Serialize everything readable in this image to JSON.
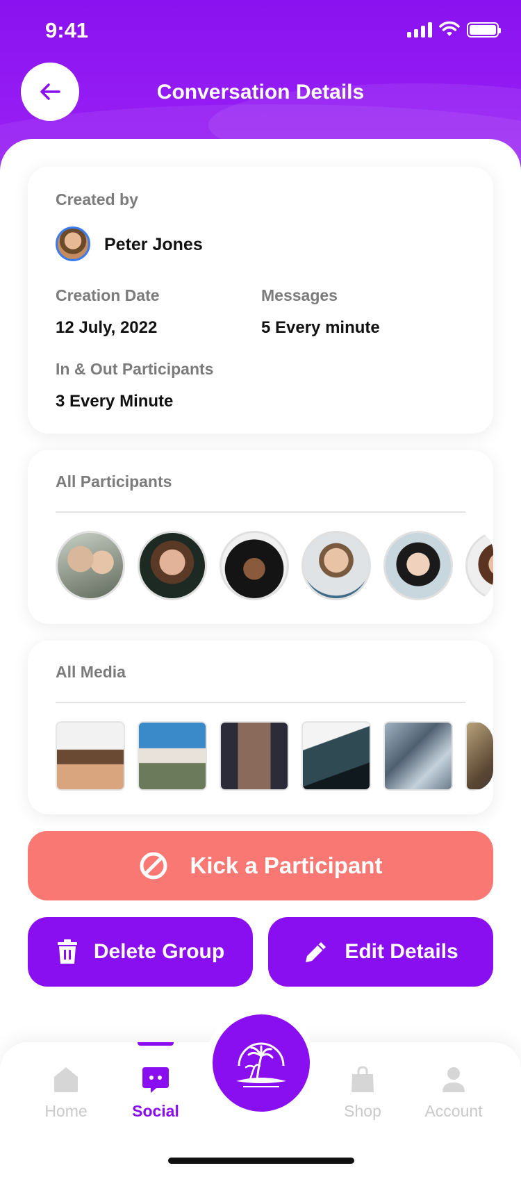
{
  "status_bar": {
    "time": "9:41"
  },
  "header": {
    "title": "Conversation Details"
  },
  "details_card": {
    "created_by_label": "Created by",
    "creator_name": "Peter Jones",
    "creation_date_label": "Creation Date",
    "creation_date_value": "12 July, 2022",
    "messages_label": "Messages",
    "messages_value": "5 Every minute",
    "participants_label": "In & Out Participants",
    "participants_value": "3 Every Minute"
  },
  "participants_card": {
    "title": "All Participants"
  },
  "media_card": {
    "title": "All Media"
  },
  "actions": {
    "kick_label": "Kick a Participant",
    "delete_label": "Delete Group",
    "edit_label": "Edit Details"
  },
  "bottom_nav": {
    "items": [
      {
        "label": "Home",
        "icon": "home-icon",
        "active": false
      },
      {
        "label": "Social",
        "icon": "chat-icon",
        "active": true
      },
      {
        "label": "Shop",
        "icon": "bag-icon",
        "active": false
      },
      {
        "label": "Account",
        "icon": "user-icon",
        "active": false
      }
    ]
  },
  "colors": {
    "primary": "#8a0ff0",
    "danger": "#f97873",
    "muted": "#7b7b7b"
  }
}
